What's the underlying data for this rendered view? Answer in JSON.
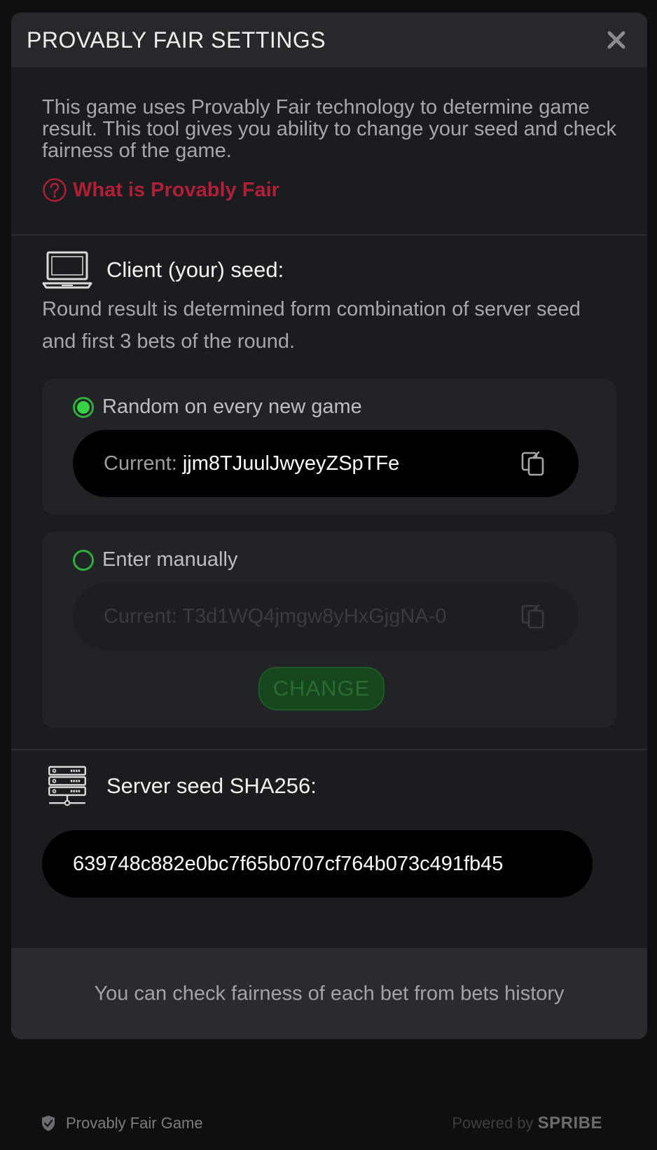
{
  "modal": {
    "title": "PROVABLY FAIR SETTINGS",
    "intro": "This game uses Provably Fair technology to determine game result. This tool gives you ability to change your seed and check fairness of the game.",
    "link_label": "What is Provably Fair"
  },
  "client": {
    "label": "Client (your) seed:",
    "description": "Round result is determined form combination of server seed and first 3 bets of the round.",
    "option_random": {
      "label": "Random on every new game",
      "current_prefix": "Current: ",
      "current_value": "jjm8TJuulJwyeyZSpTFe",
      "selected": true
    },
    "option_manual": {
      "label": "Enter manually",
      "current_prefix": "Current: ",
      "current_value": "T3d1WQ4jmgw8yHxGjgNA-0",
      "selected": false,
      "change_label": "CHANGE"
    }
  },
  "server": {
    "label": "Server seed SHA256:",
    "value": "639748c882e0bc7f65b0707cf764b073c491fb45"
  },
  "footer_note": "You can check fairness of each bet from bets history",
  "bottom": {
    "pf_game": "Provably Fair Game",
    "powered_prefix": "Powered by ",
    "brand": "SPRIBE"
  },
  "colors": {
    "accent_green": "#35d443",
    "link_red": "#b01f36",
    "modal_bg": "#1b1c1f",
    "header_bg": "#27282c"
  }
}
